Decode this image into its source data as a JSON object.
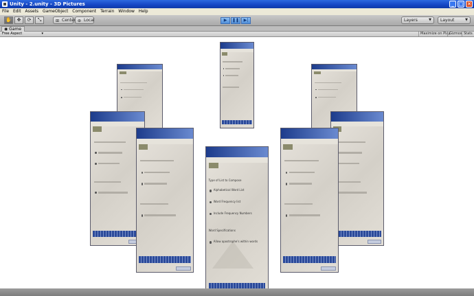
{
  "window": {
    "title": "Unity - 2.unity - 3D Pictures",
    "minimize_label": "_",
    "maximize_label": "□",
    "close_label": "✕"
  },
  "menu": {
    "items": [
      "File",
      "Edit",
      "Assets",
      "GameObject",
      "Component",
      "Terrain",
      "Window",
      "Help"
    ]
  },
  "toolbar": {
    "center_label": "Center",
    "local_label": "Local",
    "layers_label": "Layers",
    "layout_label": "Layout",
    "play_icon": "▶",
    "pause_icon": "❚❚",
    "step_icon": "▶|"
  },
  "tabs": {
    "game_label": "Game"
  },
  "game_toolbar": {
    "aspect_label": "Free Aspect",
    "maximize_label": "Maximize on Play",
    "gizmos_label": "Gizmos",
    "stats_label": "Stats"
  },
  "pictures": {
    "big_text": {
      "l1": "Type of List to Compose",
      "l2": "Alphabetical Word List",
      "l3": "Word Frequency list",
      "l4": "Include Frequency Numbers",
      "l5": "Word Specifications",
      "l6": "Allow apostrophe's within words"
    }
  },
  "accent": {
    "titlebar": "#1546c4",
    "play_button": "#4f8fd9"
  }
}
